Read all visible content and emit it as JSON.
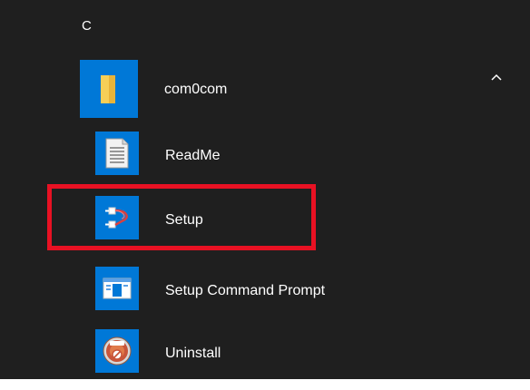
{
  "start_menu": {
    "section_letter": "C",
    "folder": {
      "label": "com0com",
      "expanded": true,
      "icon": "folder-icon"
    },
    "items": [
      {
        "label": "ReadMe",
        "icon": "document-icon"
      },
      {
        "label": "Setup",
        "icon": "setup-connector-icon"
      },
      {
        "label": "Setup Command Prompt",
        "icon": "command-prompt-icon"
      },
      {
        "label": "Uninstall",
        "icon": "uninstall-disc-icon"
      }
    ]
  },
  "colors": {
    "background": "#1f1f1f",
    "tile_blue": "#0078d7",
    "highlight_red": "#e81123",
    "text": "#ffffff"
  }
}
